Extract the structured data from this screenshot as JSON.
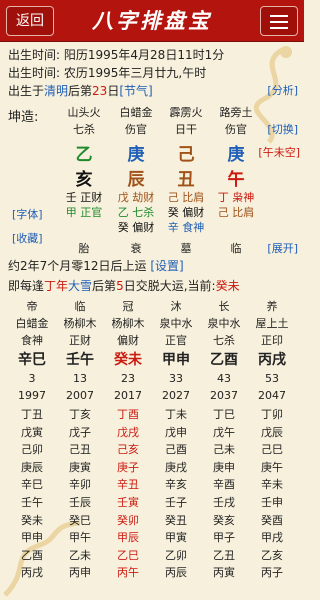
{
  "header": {
    "back": "返回",
    "title": "八字排盘宝"
  },
  "info": {
    "time_label": "出生时间:",
    "solar": "阳历1995年4月28日11时1分",
    "lunar": "农历1995年三月廿九,午时",
    "jieqi_prefix": "出生于",
    "jieqi_name": "清明",
    "jieqi_mid": "后第",
    "jieqi_day": "23",
    "jieqi_suffix": "日",
    "jieqi_link": "[节气]",
    "analysis_link": "[分析]"
  },
  "gender": "坤造:",
  "switch_link": "[切换]",
  "kongwang": "[午未空]",
  "font_link": "[字体]",
  "fav_link": "[收藏]",
  "expand_link": "[展开]",
  "pillars": [
    {
      "nayin": "山头火",
      "shishen": "七杀",
      "gan": "乙",
      "gan_color": "#1f8a2c",
      "zhi": "亥",
      "zhi_color": "#111",
      "hidden": [
        {
          "t": "壬 正财",
          "c": "#111"
        },
        {
          "t": "甲 正官",
          "c": "#1f8a2c"
        }
      ],
      "state": "胎"
    },
    {
      "nayin": "白蜡金",
      "shishen": "伤官",
      "gan": "庚",
      "gan_color": "#1f5fb8",
      "zhi": "辰",
      "zhi_color": "#a0521a",
      "hidden": [
        {
          "t": "戊 劫财",
          "c": "#a0521a"
        },
        {
          "t": "乙 七杀",
          "c": "#1f8a2c"
        },
        {
          "t": "癸 偏财",
          "c": "#111"
        }
      ],
      "state": "衰"
    },
    {
      "nayin": "霹雳火",
      "shishen": "日干",
      "gan": "己",
      "gan_color": "#a0521a",
      "zhi": "丑",
      "zhi_color": "#a0521a",
      "hidden": [
        {
          "t": "己 比肩",
          "c": "#a0521a"
        },
        {
          "t": "癸 偏财",
          "c": "#111"
        },
        {
          "t": "辛 食神",
          "c": "#1f5fb8"
        }
      ],
      "state": "墓"
    },
    {
      "nayin": "路旁土",
      "shishen": "伤官",
      "gan": "庚",
      "gan_color": "#1f5fb8",
      "zhi": "午",
      "zhi_color": "#cc1a10",
      "hidden": [
        {
          "t": "丁 枭神",
          "c": "#cc1a10"
        },
        {
          "t": "己 比肩",
          "c": "#a0521a"
        }
      ],
      "state": "临"
    }
  ],
  "dayun_start": {
    "text": "约2年7个月零12日后上运",
    "link": "[设置]"
  },
  "dayun_jiao": {
    "pre": "即每逢",
    "gan": "丁年",
    "mid1": "大雪",
    "mid2": "后第",
    "num": "5",
    "mid3": "日交脱大运,当前:",
    "current": "癸未"
  },
  "dayun": [
    {
      "state": "帝",
      "nayin": "白蜡金",
      "shishen": "食神",
      "gz": "辛巳",
      "age": "3",
      "year": "1997",
      "years": [
        "丁丑",
        "戊寅",
        "己卯",
        "庚辰",
        "辛巳",
        "壬午",
        "癸未",
        "甲申",
        "乙酉",
        "丙戌"
      ]
    },
    {
      "state": "临",
      "nayin": "杨柳木",
      "shishen": "正财",
      "gz": "壬午",
      "age": "13",
      "year": "2007",
      "years": [
        "丁亥",
        "戊子",
        "己丑",
        "庚寅",
        "辛卯",
        "壬辰",
        "癸巳",
        "甲午",
        "乙未",
        "丙申"
      ]
    },
    {
      "state": "冠",
      "nayin": "杨柳木",
      "shishen": "偏财",
      "gz": "癸未",
      "age": "23",
      "year": "2017",
      "years": [
        "丁酉",
        "戊戌",
        "己亥",
        "庚子",
        "辛丑",
        "壬寅",
        "癸卯",
        "甲辰",
        "乙巳",
        "丙午"
      ],
      "current": true
    },
    {
      "state": "沐",
      "nayin": "泉中水",
      "shishen": "正官",
      "gz": "甲申",
      "age": "33",
      "year": "2027",
      "years": [
        "丁未",
        "戊申",
        "己酉",
        "庚戌",
        "辛亥",
        "壬子",
        "癸丑",
        "甲寅",
        "乙卯",
        "丙辰"
      ]
    },
    {
      "state": "长",
      "nayin": "泉中水",
      "shishen": "七杀",
      "gz": "乙酉",
      "age": "43",
      "year": "2037",
      "years": [
        "丁巳",
        "戊午",
        "己未",
        "庚申",
        "辛酉",
        "壬戌",
        "癸亥",
        "甲子",
        "乙丑",
        "丙寅"
      ]
    },
    {
      "state": "养",
      "nayin": "屋上土",
      "shishen": "正印",
      "gz": "丙戌",
      "age": "53",
      "year": "2047",
      "years": [
        "丁卯",
        "戊辰",
        "己巳",
        "庚午",
        "辛未",
        "壬申",
        "癸酉",
        "甲戌",
        "乙亥",
        "丙子"
      ]
    }
  ]
}
